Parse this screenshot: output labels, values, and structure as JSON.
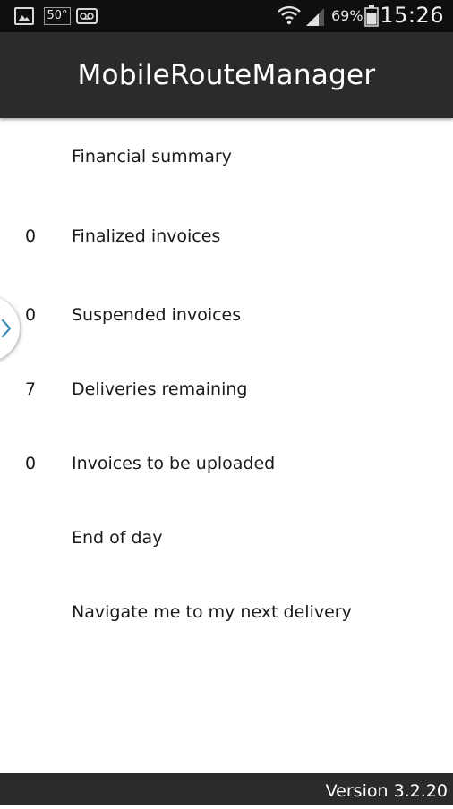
{
  "status_bar": {
    "weather_text": "50°",
    "battery_percent": "69%",
    "time": "15:26",
    "icons": [
      "image-icon",
      "weather-icon",
      "voicemail-icon",
      "wifi-icon",
      "signal-icon",
      "battery-icon"
    ]
  },
  "app": {
    "title": "MobileRouteManager"
  },
  "menu": {
    "items": [
      {
        "count": "",
        "label": "Financial summary"
      },
      {
        "count": "0",
        "label": "Finalized invoices"
      },
      {
        "count": "0",
        "label": "Suspended invoices"
      },
      {
        "count": "7",
        "label": "Deliveries remaining"
      },
      {
        "count": "0",
        "label": "Invoices to be uploaded"
      },
      {
        "count": "",
        "label": "End of day"
      },
      {
        "count": "",
        "label": "Navigate me to my next delivery"
      }
    ]
  },
  "footer": {
    "version": "Version 3.2.20"
  },
  "colors": {
    "status_bar_bg": "#0f0f0f",
    "action_bar_bg": "#2b2b2b",
    "accent_chevron": "#3b8fb8"
  }
}
